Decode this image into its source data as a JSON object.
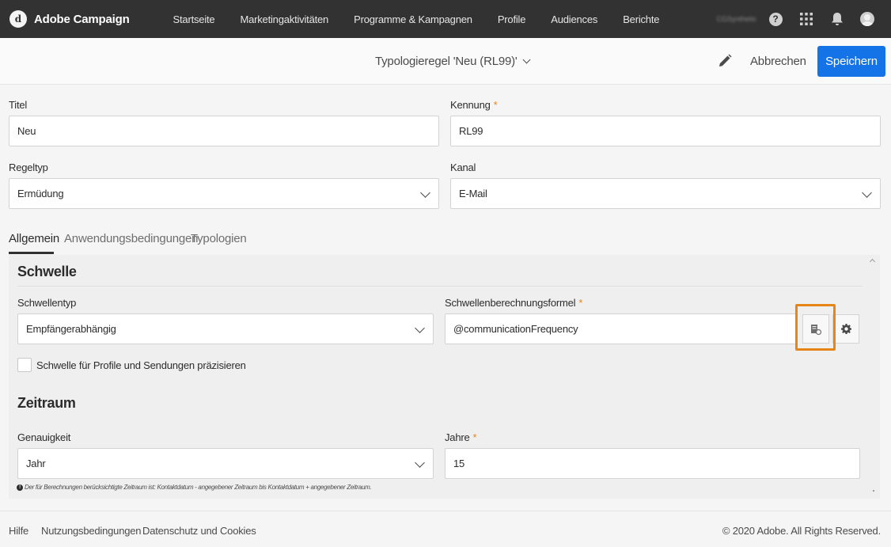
{
  "app": {
    "name": "Adobe Campaign",
    "logo_glyph": "d"
  },
  "nav": {
    "items": [
      "Startseite",
      "Marketingaktivitäten",
      "Programme & Kampagnen",
      "Profile",
      "Audiences",
      "Berichte"
    ],
    "org_name": "CGSynthetic",
    "help_glyph": "?"
  },
  "header": {
    "title": "Typologieregel 'Neu (RL99)'",
    "cancel_label": "Abbrechen",
    "save_label": "Speichern"
  },
  "form": {
    "title_label": "Titel",
    "title_value": "Neu",
    "id_label": "Kennung",
    "id_value": "RL99",
    "rule_type_label": "Regeltyp",
    "rule_type_value": "Ermüdung",
    "channel_label": "Kanal",
    "channel_value": "E-Mail",
    "required_mark": "*"
  },
  "tabs": [
    "Allgemein",
    "Anwendungsbedingungen",
    "Typologien"
  ],
  "threshold": {
    "section_title": "Schwelle",
    "type_label": "Schwellentyp",
    "type_value": "Empfängerabhängig",
    "formula_label": "Schwellenberechnungsformel",
    "formula_value": "@communicationFrequency",
    "checkbox_label": "Schwelle für Profile und Sendungen präzisieren"
  },
  "period": {
    "section_title": "Zeitraum",
    "precision_label": "Genauigkeit",
    "precision_value": "Jahr",
    "years_label": "Jahre",
    "years_value": "15",
    "note": "Der für Berechnungen berücksichtigte Zeitraum ist: Kontaktdatum - angegebener Zeitraum bis Kontaktdatum + angegebener Zeitraum.",
    "info_glyph": "!"
  },
  "footer": {
    "links": [
      "Hilfe",
      "Nutzungsbedingungen",
      "Datenschutz und Cookies"
    ],
    "copyright": "© 2020 Adobe. All Rights Reserved."
  },
  "colors": {
    "nav_bg": "#323232",
    "accent_blue": "#1473e6",
    "highlight_orange": "#e68619",
    "required_orange": "#e68619"
  }
}
